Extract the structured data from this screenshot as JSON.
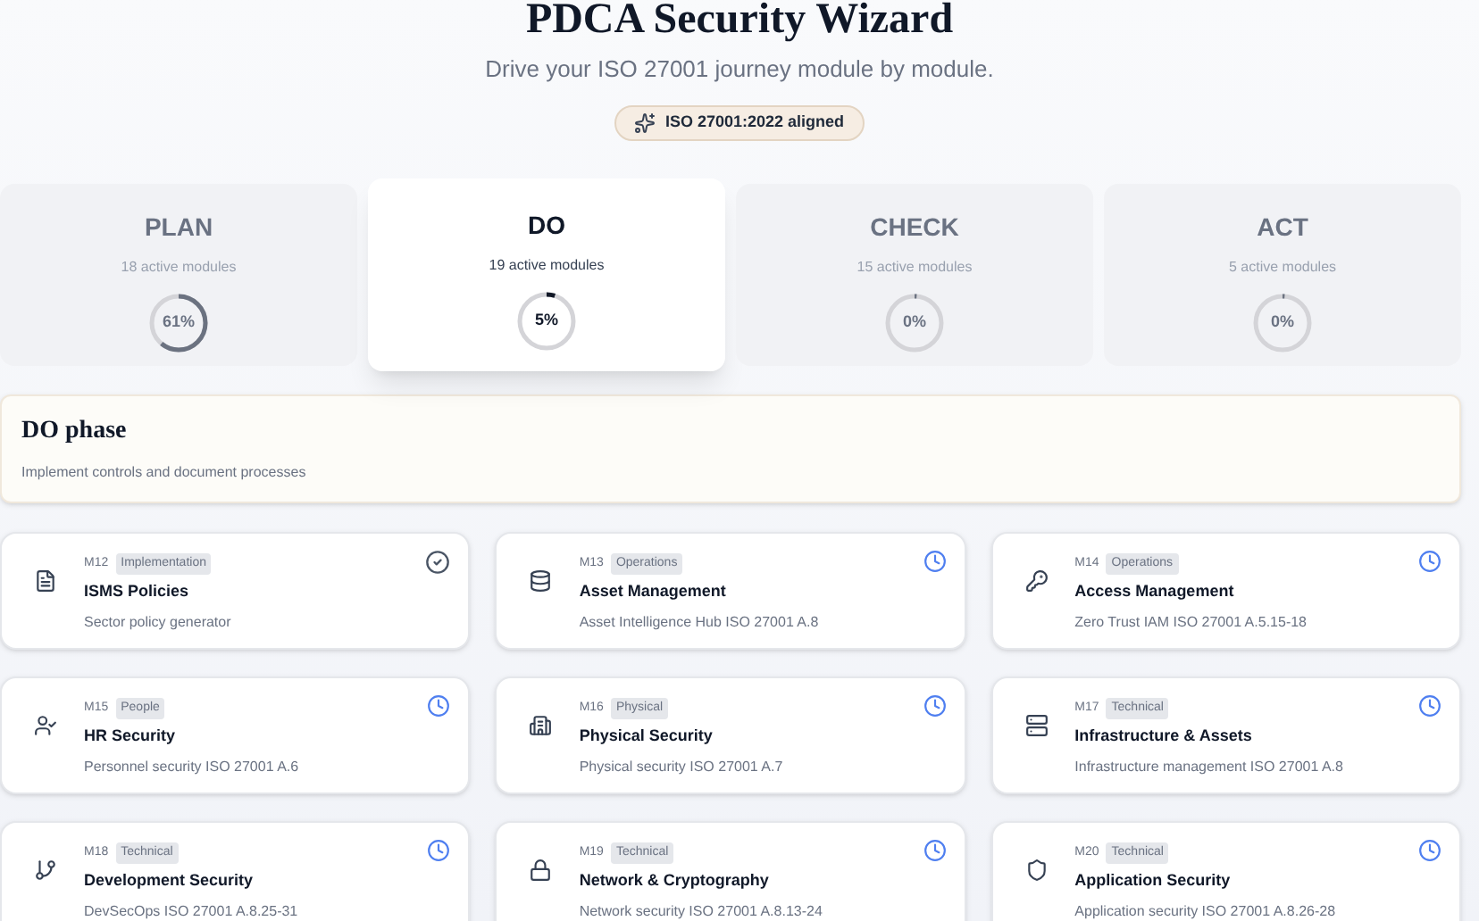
{
  "header": {
    "title": "PDCA Security Wizard",
    "subtitle": "Drive your ISO 27001 journey module by module.",
    "badge": "ISO 27001:2022 aligned"
  },
  "phases": [
    {
      "name": "PLAN",
      "modules": "18 active modules",
      "level": 0.61,
      "reading": "61%",
      "selected": false
    },
    {
      "name": "DO",
      "modules": "19 active modules",
      "level": 0.05,
      "reading": "5%",
      "selected": true
    },
    {
      "name": "CHECK",
      "modules": "15 active modules",
      "level": 0,
      "reading": "0%",
      "selected": false
    },
    {
      "name": "ACT",
      "modules": "5 active modules",
      "level": 0,
      "reading": "0%",
      "selected": false
    }
  ],
  "phase_banner": {
    "title": "DO phase",
    "description": "Implement controls and document processes"
  },
  "modules": [
    {
      "code": "M12",
      "tag": "Implementation",
      "title": "ISMS Policies",
      "description": "Sector policy generator",
      "kind": "done"
    },
    {
      "code": "M13",
      "tag": "Operations",
      "title": "Asset Management",
      "description": "Asset Intelligence Hub ISO 27001 A.8",
      "kind": "pending"
    },
    {
      "code": "M14",
      "tag": "Operations",
      "title": "Access Management",
      "description": "Zero Trust IAM ISO 27001 A.5.15-18",
      "kind": "pending"
    },
    {
      "code": "M15",
      "tag": "People",
      "title": "HR Security",
      "description": "Personnel security ISO 27001 A.6",
      "kind": "pending"
    },
    {
      "code": "M16",
      "tag": "Physical",
      "title": "Physical Security",
      "description": "Physical security ISO 27001 A.7",
      "kind": "pending"
    },
    {
      "code": "M17",
      "tag": "Technical",
      "title": "Infrastructure & Assets",
      "description": "Infrastructure management ISO 27001 A.8",
      "kind": "pending"
    },
    {
      "code": "M18",
      "tag": "Technical",
      "title": "Development Security",
      "description": "DevSecOps ISO 27001 A.8.25-31",
      "kind": "pending"
    },
    {
      "code": "M19",
      "tag": "Technical",
      "title": "Network & Cryptography",
      "description": "Network security ISO 27001 A.8.13-24",
      "kind": "pending"
    },
    {
      "code": "M20",
      "tag": "Technical",
      "title": "Application Security",
      "description": "Application security ISO 27001 A.8.26-28",
      "kind": "pending"
    }
  ]
}
